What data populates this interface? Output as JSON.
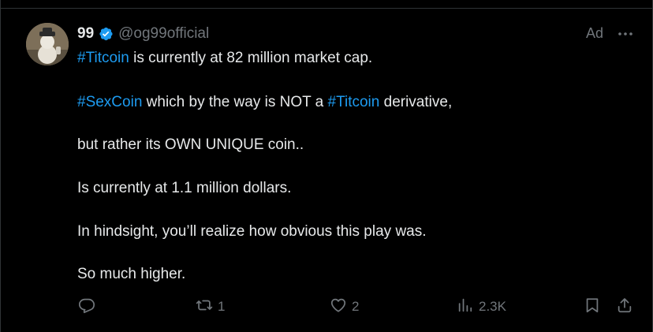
{
  "post": {
    "display_name": "99",
    "handle": "@og99official",
    "ad_label": "Ad",
    "lines": [
      {
        "segments": [
          {
            "text": "#Titcoin",
            "hashtag": true
          },
          {
            "text": " is currently at 82 million market cap.",
            "hashtag": false
          }
        ]
      },
      {
        "segments": [
          {
            "text": "#SexCoin",
            "hashtag": true
          },
          {
            "text": " which by the way is NOT a ",
            "hashtag": false
          },
          {
            "text": "#Titcoin",
            "hashtag": true
          },
          {
            "text": " derivative,",
            "hashtag": false
          }
        ]
      },
      {
        "segments": [
          {
            "text": "but rather its OWN UNIQUE coin..",
            "hashtag": false
          }
        ]
      },
      {
        "segments": [
          {
            "text": "Is currently at 1.1 million dollars.",
            "hashtag": false
          }
        ]
      },
      {
        "segments": [
          {
            "text": "In hindsight, you’ll realize how obvious this play was.",
            "hashtag": false
          }
        ]
      },
      {
        "segments": [
          {
            "text": "So much higher.",
            "hashtag": false
          }
        ]
      }
    ]
  },
  "actions": {
    "reply_count": "",
    "repost_count": "1",
    "like_count": "2",
    "views_count": "2.3K"
  },
  "icons": {
    "verified": "verified-badge-icon",
    "more": "more-horizontal-icon",
    "reply": "reply-icon",
    "repost": "repost-icon",
    "like": "heart-icon",
    "views": "views-icon",
    "bookmark": "bookmark-icon",
    "share": "share-icon"
  },
  "colors": {
    "background": "#000000",
    "text": "#e7e9ea",
    "muted": "#71767b",
    "accent": "#1d9bf0",
    "border": "#2f3336"
  }
}
